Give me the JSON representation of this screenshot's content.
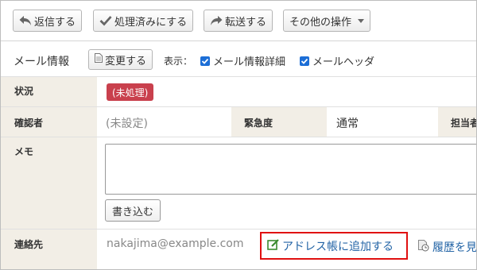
{
  "toolbar": {
    "reply_label": "返信する",
    "processed_label": "処理済みにする",
    "forward_label": "転送する",
    "other_label": "その他の操作"
  },
  "mail_info": {
    "title": "メール情報",
    "change_label": "変更する",
    "display_label": "表示：",
    "detail_checkbox_label": "メール情報詳細",
    "detail_checked": true,
    "header_checkbox_label": "メールヘッダ",
    "header_checked": true
  },
  "properties": {
    "status_label": "状況",
    "status_value": "(未処理)",
    "status_color": "#c9404d",
    "confirmer_label": "確認者",
    "confirmer_value": "(未設定)",
    "urgency_label": "緊急度",
    "urgency_value": "通常",
    "assignee_label": "担当者",
    "memo_label": "メモ",
    "memo_value": "",
    "write_label": "書き込む",
    "contact_label": "連絡先",
    "contact_value": "nakajima@example.com",
    "add_address_label": "アドレス帳に追加する",
    "history_label": "履歴を見"
  },
  "colors": {
    "link": "#2364a6",
    "highlight_border": "#e01010",
    "label_bg": "#f2eee6"
  }
}
